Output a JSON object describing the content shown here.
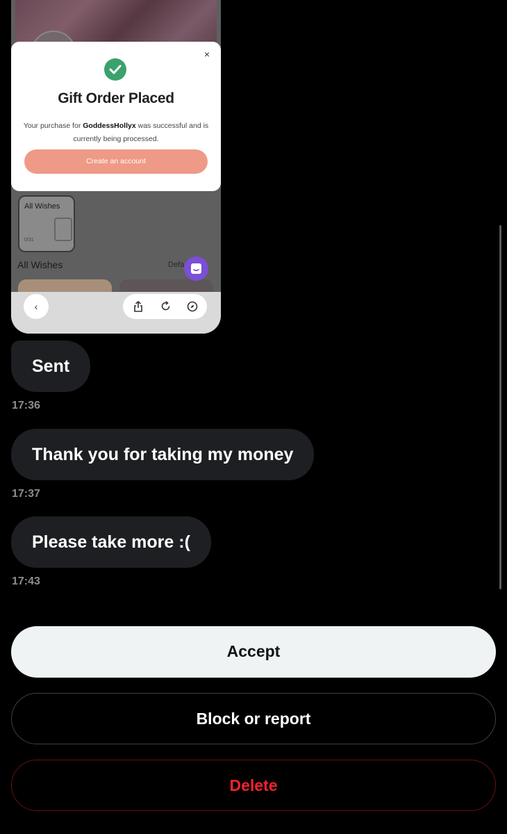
{
  "screenshot": {
    "modal": {
      "close_glyph": "×",
      "title": "Gift Order Placed",
      "body_prefix": "Your purchase for ",
      "body_name": "GoddessHollyx",
      "body_suffix": " was successful and is currently being processed.",
      "cta_label": "Create an account",
      "check_color": "#3aa26a",
      "cta_color": "#ee9a86"
    },
    "wishes": {
      "tile_label": "All Wishes",
      "tile_count": "0/31",
      "section_title": "All Wishes",
      "sort_label": "Defa"
    },
    "browser": {
      "back_glyph": "‹",
      "icons": [
        "share-icon",
        "reload-icon",
        "compass-icon"
      ]
    }
  },
  "messages": [
    {
      "text": "Sent",
      "time": "17:36"
    },
    {
      "text": "Thank you for taking my money",
      "time": "17:37"
    },
    {
      "text": "Please take more :(",
      "time": "17:43"
    }
  ],
  "actions": {
    "accept": "Accept",
    "block": "Block or report",
    "delete": "Delete"
  },
  "colors": {
    "background": "#000000",
    "bubble": "#1e1f22",
    "timestamp": "#8a8d92",
    "accept_bg": "#eff3f4",
    "delete_text": "#f4212e"
  }
}
